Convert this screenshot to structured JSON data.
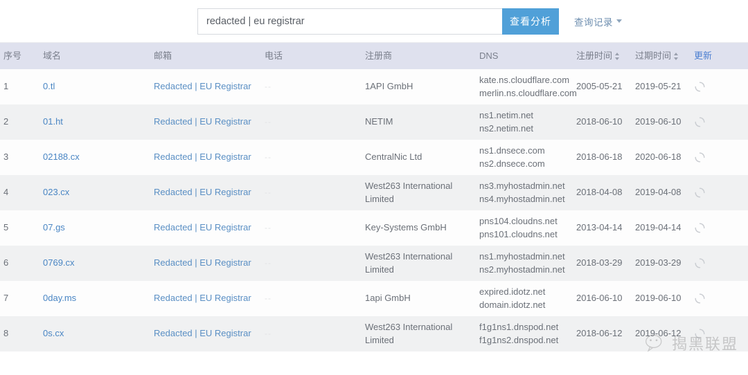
{
  "search": {
    "value": "redacted | eu registrar",
    "placeholder": "redacted | eu registrar",
    "analyze_label": "查看分析",
    "records_label": "查询记录"
  },
  "table": {
    "headers": {
      "index": "序号",
      "domain": "域名",
      "email": "邮箱",
      "phone": "电话",
      "registrar": "注册商",
      "dns": "DNS",
      "reg_time": "注册时间",
      "exp_time": "过期时间",
      "update": "更新"
    },
    "rows": [
      {
        "index": "1",
        "domain": "0.tl",
        "email": "Redacted | EU Registrar",
        "phone": "--",
        "registrar": "1API GmbH",
        "dns1": "kate.ns.cloudflare.com",
        "dns2": "merlin.ns.cloudflare.com",
        "reg_time": "2005-05-21",
        "exp_time": "2019-05-21"
      },
      {
        "index": "2",
        "domain": "01.ht",
        "email": "Redacted | EU Registrar",
        "phone": "--",
        "registrar": "NETIM",
        "dns1": "ns1.netim.net",
        "dns2": "ns2.netim.net",
        "reg_time": "2018-06-10",
        "exp_time": "2019-06-10"
      },
      {
        "index": "3",
        "domain": "02188.cx",
        "email": "Redacted | EU Registrar",
        "phone": "--",
        "registrar": "CentralNic Ltd",
        "dns1": "ns1.dnsece.com",
        "dns2": "ns2.dnsece.com",
        "reg_time": "2018-06-18",
        "exp_time": "2020-06-18"
      },
      {
        "index": "4",
        "domain": "023.cx",
        "email": "Redacted | EU Registrar",
        "phone": "--",
        "registrar": "West263 International Limited",
        "dns1": "ns3.myhostadmin.net",
        "dns2": "ns4.myhostadmin.net",
        "reg_time": "2018-04-08",
        "exp_time": "2019-04-08"
      },
      {
        "index": "5",
        "domain": "07.gs",
        "email": "Redacted | EU Registrar",
        "phone": "--",
        "registrar": "Key-Systems GmbH",
        "dns1": "pns104.cloudns.net",
        "dns2": "pns101.cloudns.net",
        "reg_time": "2013-04-14",
        "exp_time": "2019-04-14"
      },
      {
        "index": "6",
        "domain": "0769.cx",
        "email": "Redacted | EU Registrar",
        "phone": "--",
        "registrar": "West263 International Limited",
        "dns1": "ns1.myhostadmin.net",
        "dns2": "ns2.myhostadmin.net",
        "reg_time": "2018-03-29",
        "exp_time": "2019-03-29"
      },
      {
        "index": "7",
        "domain": "0day.ms",
        "email": "Redacted | EU Registrar",
        "phone": "--",
        "registrar": "1api GmbH",
        "dns1": "expired.idotz.net",
        "dns2": "domain.idotz.net",
        "reg_time": "2016-06-10",
        "exp_time": "2019-06-10"
      },
      {
        "index": "8",
        "domain": "0s.cx",
        "email": "Redacted | EU Registrar",
        "phone": "--",
        "registrar": "West263 International Limited",
        "dns1": "f1g1ns1.dnspod.net",
        "dns2": "f1g1ns2.dnspod.net",
        "reg_time": "2018-06-12",
        "exp_time": "2019-06-12"
      }
    ]
  },
  "watermark": {
    "text": "揭黑联盟"
  },
  "colors": {
    "accent": "#50a0d8",
    "link": "#5a8fc4",
    "header_bg": "#dfe1ee",
    "row_even": "#f0f1f2"
  }
}
